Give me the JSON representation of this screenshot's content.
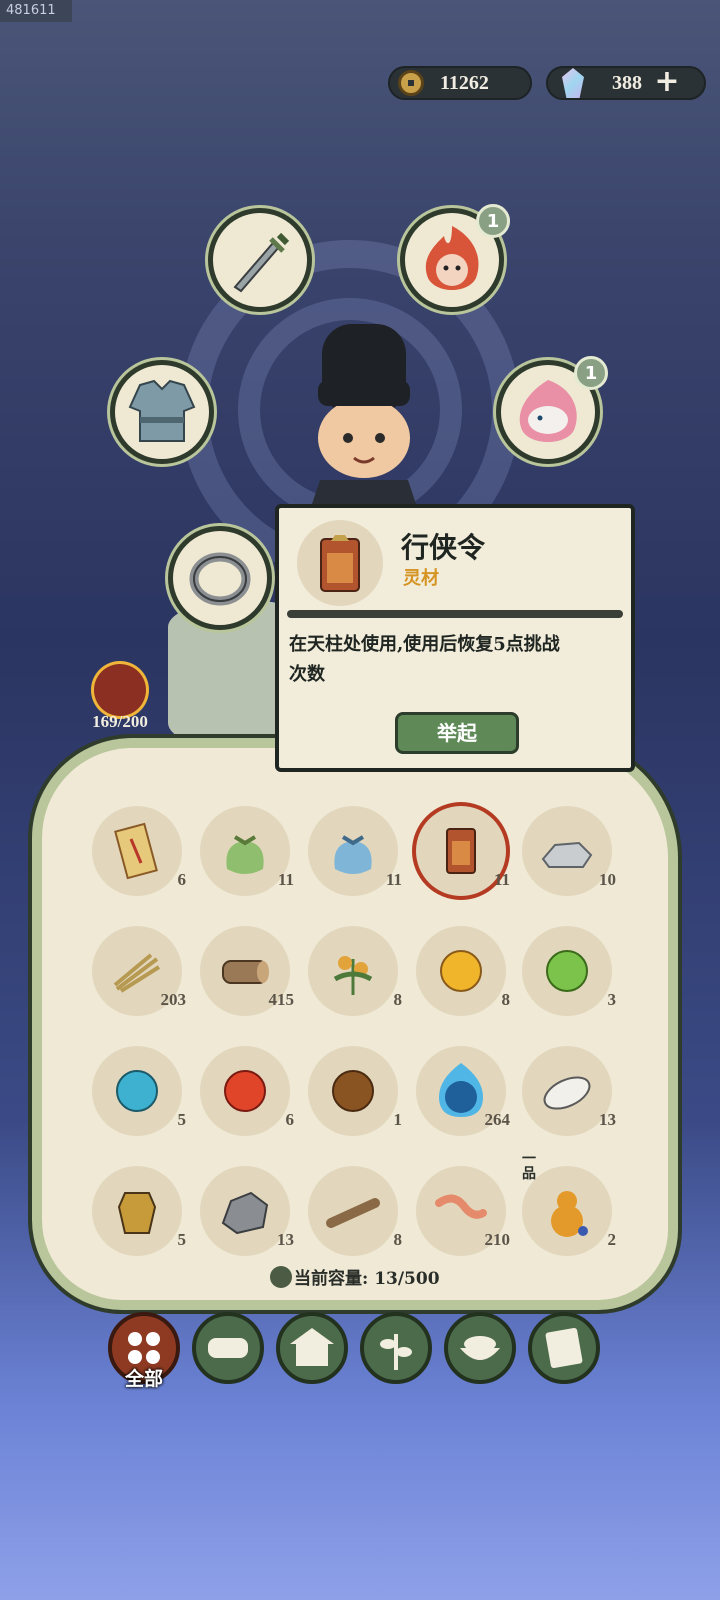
{
  "build_id": "481611",
  "currency": {
    "coins": "11262",
    "gems": "388",
    "plus_label": "+"
  },
  "equip_slots": [
    {
      "name": "sword",
      "badge": ""
    },
    {
      "name": "fire-spirit",
      "badge": "1"
    },
    {
      "name": "armor",
      "badge": ""
    },
    {
      "name": "beast-spirit",
      "badge": "1"
    },
    {
      "name": "ring",
      "badge": ""
    }
  ],
  "stamina": {
    "value": "169/200"
  },
  "tooltip": {
    "title": "行侠令",
    "category": "灵材",
    "description_line1": "在天柱处使用,使用后恢复5点挑战",
    "description_line2": "次数",
    "action_label": "举起"
  },
  "inventory": {
    "items": [
      {
        "icon": "talisman-scroll-icon",
        "count": "6"
      },
      {
        "icon": "green-pouch-icon",
        "count": "11"
      },
      {
        "icon": "blue-pouch-icon",
        "count": "11"
      },
      {
        "icon": "xing-xia-token-icon",
        "count": "11",
        "selected": true
      },
      {
        "icon": "stones-icon",
        "count": "10"
      },
      {
        "icon": "grass-bundle-icon",
        "count": "203"
      },
      {
        "icon": "wood-log-icon",
        "count": "415"
      },
      {
        "icon": "herb-flower-icon",
        "count": "8"
      },
      {
        "icon": "gold-orb-icon",
        "count": "8"
      },
      {
        "icon": "green-orb-icon",
        "count": "3"
      },
      {
        "icon": "cyan-orb-icon",
        "count": "5"
      },
      {
        "icon": "red-orb-icon",
        "count": "6"
      },
      {
        "icon": "brown-orb-icon",
        "count": "1"
      },
      {
        "icon": "blue-flame-orb-icon",
        "count": "264"
      },
      {
        "icon": "white-stone-icon",
        "count": "13"
      },
      {
        "icon": "lantern-seal-icon",
        "count": "5"
      },
      {
        "icon": "grey-rock-icon",
        "count": "13"
      },
      {
        "icon": "branch-icon",
        "count": "8"
      },
      {
        "icon": "earthworm-icon",
        "count": "210"
      },
      {
        "icon": "gourd-icon",
        "count": "2",
        "rank": "一品"
      }
    ],
    "capacity": "当前容量: 13/500"
  },
  "categories": [
    {
      "icon": "all-icon",
      "label": "全部",
      "active": true
    },
    {
      "icon": "log-icon",
      "label": ""
    },
    {
      "icon": "house-icon",
      "label": ""
    },
    {
      "icon": "herb-icon",
      "label": ""
    },
    {
      "icon": "food-bowl-icon",
      "label": ""
    },
    {
      "icon": "scroll-icon",
      "label": ""
    }
  ],
  "colors": {
    "accent_green": "#5f8a58",
    "tooltip_category": "#d59423",
    "selected_ring": "#b43a22"
  }
}
